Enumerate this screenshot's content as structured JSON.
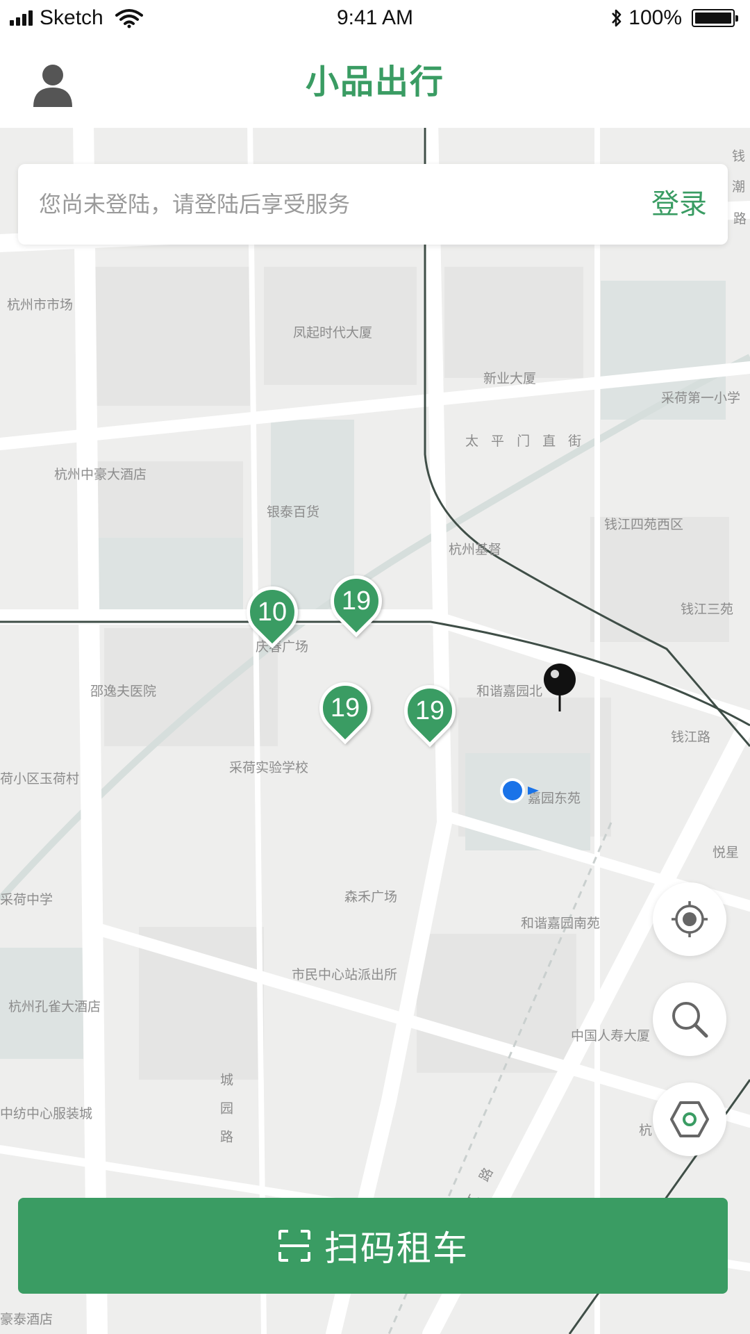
{
  "status_bar": {
    "carrier": "Sketch",
    "time": "9:41 AM",
    "battery": "100%"
  },
  "header": {
    "title": "小品出行",
    "avatar_icon": "user-icon"
  },
  "login_card": {
    "prompt": "您尚未登陆，请登陆后享受服务",
    "login_label": "登录"
  },
  "map": {
    "labels": [
      "杭州市市场",
      "凤起时代大厦",
      "新业大厦",
      "采荷第一小学",
      "太 平 门 直 街",
      "杭州中豪大酒店",
      "银泰百货",
      "杭州基督",
      "钱江四苑西区",
      "钱江三苑",
      "庆春广场",
      "邵逸夫医院",
      "和谐嘉园北",
      "钱江路",
      "采荷实验学校",
      "荷小区玉荷村",
      "嘉园东苑",
      "悦星",
      "采荷中学",
      "森禾广场",
      "和谐嘉园南苑",
      "市民中心站派出所",
      "杭州孔雀大酒店",
      "中国人寿大厦",
      "城园路",
      "中纺中心服装城",
      "钱江路",
      "杭",
      "豪泰酒店",
      "钱",
      "潮",
      "路"
    ],
    "bike_clusters": [
      "10",
      "19",
      "19",
      "19"
    ]
  },
  "controls": {
    "locate_icon": "target-icon",
    "search_icon": "search-icon",
    "nearby_icon": "hexagon-nut-icon"
  },
  "scan_button": {
    "label": "扫码租车",
    "icon": "scan-icon"
  },
  "colors": {
    "brand_green": "#3a9c63",
    "location_blue": "#1a73e8"
  }
}
